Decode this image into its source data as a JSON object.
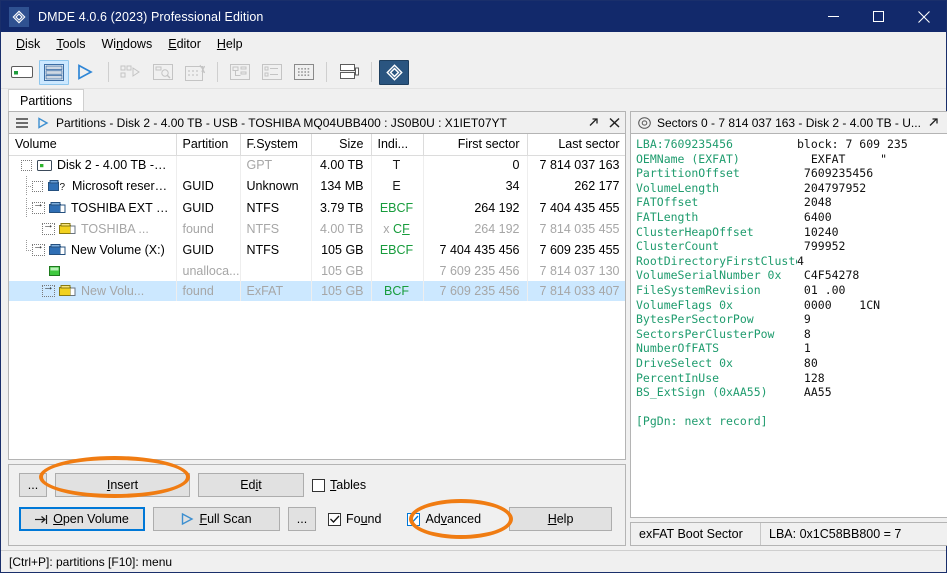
{
  "window": {
    "title": "DMDE 4.0.6 (2023) Professional Edition",
    "logo_icon": "dmde-logo-icon",
    "minimize_label": "Minimize",
    "maximize_label": "Maximize",
    "close_label": "Close"
  },
  "menubar": [
    {
      "label": "Disk",
      "accel": "D"
    },
    {
      "label": "Tools",
      "accel": "T"
    },
    {
      "label": "Windows",
      "accel": "n"
    },
    {
      "label": "Editor",
      "accel": "E"
    },
    {
      "label": "Help",
      "accel": "H"
    }
  ],
  "toolbar": [
    {
      "name": "drive-icon",
      "state": "normal"
    },
    {
      "name": "partitions-list-icon",
      "state": "active"
    },
    {
      "name": "run-icon",
      "state": "normal"
    },
    {
      "name": "separator"
    },
    {
      "name": "raid-icon",
      "state": "disabled"
    },
    {
      "name": "search-sectors-icon",
      "state": "disabled"
    },
    {
      "name": "new-scan-icon",
      "state": "disabled"
    },
    {
      "name": "separator"
    },
    {
      "name": "tree-view-icon",
      "state": "disabled"
    },
    {
      "name": "list-view-icon",
      "state": "disabled"
    },
    {
      "name": "hex-view-icon",
      "state": "normal"
    },
    {
      "name": "separator"
    },
    {
      "name": "clone-icon",
      "state": "normal"
    },
    {
      "name": "separator"
    },
    {
      "name": "dmde-brand-icon",
      "state": "accent"
    }
  ],
  "tabs": [
    {
      "label": "Partitions",
      "active": true
    }
  ],
  "partitions_panel": {
    "title": "Partitions - Disk 2 - 4.00 TB - USB - TOSHIBA MQ04UBB400 : JS0B0U : X1IET07YT",
    "menu_icon": "hamburger-icon",
    "play_icon": "play-triangle-icon",
    "restore_icon": "restore-window-icon",
    "close_icon": "close-window-icon",
    "columns": [
      "Volume",
      "Partition",
      "F.System",
      "Size",
      "Indi...",
      "First sector",
      "Last sector"
    ],
    "rows": [
      {
        "volume": "Disk 2 - 4.00 TB - U...",
        "partition": "",
        "fsystem": "GPT",
        "size": "4.00 TB",
        "indicators": [
          {
            "t": "T",
            "c": "dark"
          }
        ],
        "first_sector": "0",
        "last_sector": "7 814 037 163",
        "indent": 0,
        "icon": "disk-icon",
        "control": "checkbox",
        "dim": false,
        "fs_dim": true,
        "selected": false
      },
      {
        "volume": "Microsoft reserv...",
        "partition": "GUID",
        "fsystem": "Unknown",
        "size": "134 MB",
        "indicators": [
          {
            "t": "E",
            "c": "dark"
          }
        ],
        "first_sector": "34",
        "last_sector": "262 177",
        "indent": 1,
        "icon": "volume-unknown-icon",
        "control": "checkbox",
        "dim": false,
        "fs_dim": false,
        "selected": false
      },
      {
        "volume": "TOSHIBA EXT (E:)",
        "partition": "GUID",
        "fsystem": "NTFS",
        "size": "3.79 TB",
        "indicators": [
          {
            "t": "EBCF",
            "c": "green"
          }
        ],
        "first_sector": "264 192",
        "last_sector": "7 404 435 455",
        "indent": 1,
        "icon": "volume-blue-icon",
        "control": "arrow",
        "dim": false,
        "fs_dim": false,
        "selected": false
      },
      {
        "volume": "TOSHIBA ...",
        "partition": "found",
        "fsystem": "NTFS",
        "size": "4.00 TB",
        "indicators": [
          {
            "t": "x ",
            "c": "gray"
          },
          {
            "t": "CF",
            "c": "green"
          }
        ],
        "first_sector": "264 192",
        "last_sector": "7 814 035 455",
        "indent": 2,
        "icon": "volume-yellow-icon",
        "control": "arrow",
        "dim": true,
        "fs_dim": true,
        "selected": false
      },
      {
        "volume": "New Volume (X:)",
        "partition": "GUID",
        "fsystem": "NTFS",
        "size": "105 GB",
        "indicators": [
          {
            "t": "EBCF",
            "c": "green"
          }
        ],
        "first_sector": "7 404 435 456",
        "last_sector": "7 609 235 455",
        "indent": 1,
        "icon": "volume-blue-icon",
        "control": "arrow",
        "dim": false,
        "fs_dim": false,
        "selected": false
      },
      {
        "volume": "",
        "partition": "unalloca...",
        "fsystem": "",
        "size": "105 GB",
        "indicators": [],
        "first_sector": "7 609 235 456",
        "last_sector": "7 814 037 130",
        "indent": 2,
        "icon": "unallocated-icon",
        "control": "none",
        "dim": true,
        "fs_dim": true,
        "selected": false
      },
      {
        "volume": "New Volu...",
        "partition": "found",
        "fsystem": "ExFAT",
        "size": "105 GB",
        "indicators": [
          {
            "t": "BCF",
            "c": "green"
          }
        ],
        "first_sector": "7 609 235 456",
        "last_sector": "7 814 033 407",
        "indent": 2,
        "icon": "volume-yellow-icon",
        "control": "arrow",
        "dim": true,
        "fs_dim": true,
        "selected": true
      }
    ]
  },
  "buttons": {
    "more_top": "...",
    "insert": "Insert",
    "insert_accel": "I",
    "edit": "Edit",
    "edit_accel": "i",
    "tables_checkbox": {
      "label": "Tables",
      "accel": "T",
      "checked": false
    },
    "open_volume": "Open Volume",
    "open_volume_accel": "O",
    "full_scan": "Full Scan",
    "full_scan_accel": "F",
    "more_bottom": "...",
    "found_checkbox": {
      "label": "Found",
      "accel": "u",
      "checked": true
    },
    "advanced_checkbox": {
      "label": "Advanced",
      "accel": "v",
      "checked": true
    },
    "help": "Help",
    "help_accel": "H"
  },
  "sectors_panel": {
    "title": "Sectors 0 - 7 814 037 163 - Disk 2 - 4.00 TB - U...",
    "disk_icon": "sector-disk-icon",
    "restore_icon": "restore-window-icon",
    "close_icon": "close-window-icon",
    "lines": [
      {
        "key": "LBA:7609235456",
        "val": "block: 7 609 235 "
      },
      {
        "key": "OEMName (EXFAT)",
        "val": "  EXFAT     \""
      },
      {
        "key": "PartitionOffset",
        "val": " 7609235456"
      },
      {
        "key": "VolumeLength",
        "val": " 204797952"
      },
      {
        "key": "FATOffset",
        "val": " 2048"
      },
      {
        "key": "FATLength",
        "val": " 6400"
      },
      {
        "key": "ClusterHeapOffset",
        "val": " 10240"
      },
      {
        "key": "ClusterCount",
        "val": " 799952"
      },
      {
        "key": "RootDirectoryFirstCluste",
        "val": "4"
      },
      {
        "key": "VolumeSerialNumber 0x",
        "val": " C4F54278"
      },
      {
        "key": "FileSystemRevision",
        "val": " 01 .00"
      },
      {
        "key": "VolumeFlags 0x",
        "val": " 0000    1CN"
      },
      {
        "key": "BytesPerSectorPow",
        "val": " 9"
      },
      {
        "key": "SectorsPerClusterPow",
        "val": " 8"
      },
      {
        "key": "NumberOfFATS",
        "val": " 1"
      },
      {
        "key": "DriveSelect 0x",
        "val": " 80"
      },
      {
        "key": "PercentInUse",
        "val": " 128"
      },
      {
        "key": "BS_ExtSign (0xAA55)",
        "val": " AA55"
      },
      {
        "key": "",
        "val": ""
      },
      {
        "key": "[PgDn: next record]",
        "val": ""
      }
    ],
    "status_left": "exFAT Boot Sector",
    "status_right": "LBA: 0x1C58BB800 = 7",
    "scroll_up_icon": "chevron-up-icon",
    "scroll_down_icon": "chevron-down-icon"
  },
  "statusbar": {
    "text": "[Ctrl+P]: partitions  [F10]: menu"
  },
  "annotations": {
    "highlight_color": "#f07c12",
    "ellipse_insert": "insert-button-highlight",
    "ellipse_advanced": "advanced-checkbox-highlight"
  }
}
